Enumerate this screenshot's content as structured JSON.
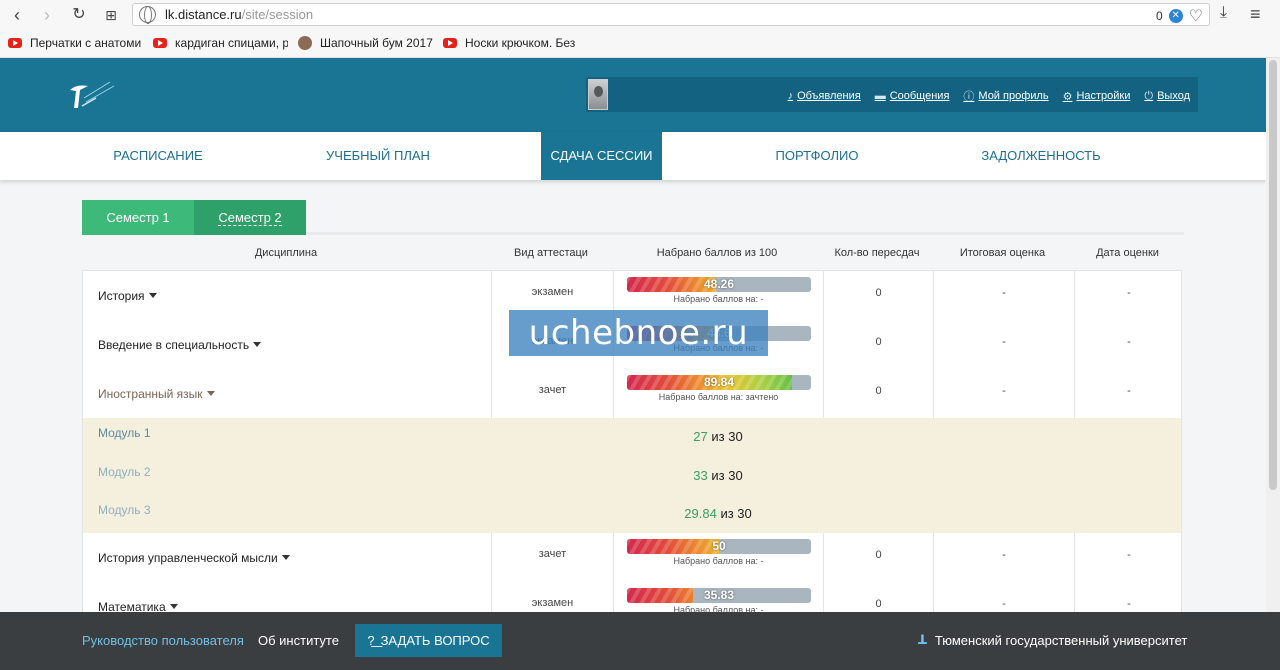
{
  "browser": {
    "url_host": "lk.distance.ru",
    "url_path": "/site/session",
    "badge_count": "0"
  },
  "bookmarks": [
    {
      "label": "Перчатки с анатоми"
    },
    {
      "label": "кардиган спицами, р"
    },
    {
      "label": "Шапочный бум 2017"
    },
    {
      "label": "Носки крючком. Без"
    }
  ],
  "header": {
    "links": [
      {
        "label": "Объявления",
        "icon": "bell-icon"
      },
      {
        "label": "Сообщения",
        "icon": "message-icon"
      },
      {
        "label": "Мой профиль",
        "icon": "info-icon"
      },
      {
        "label": "Настройки",
        "icon": "gear-icon"
      },
      {
        "label": "Выход",
        "icon": "power-icon"
      }
    ]
  },
  "nav": {
    "tabs": [
      {
        "label": "РАСПИСАНИЕ"
      },
      {
        "label": "УЧЕБНЫЙ ПЛАН"
      },
      {
        "label": "СДАЧА СЕССИИ",
        "active": true
      },
      {
        "label": "ПОРТФОЛИО"
      },
      {
        "label": "ЗАДОЛЖЕННОСТЬ"
      }
    ]
  },
  "semesters": {
    "tab1": "Семестр 1",
    "tab2": "Семестр 2"
  },
  "table": {
    "headers": {
      "discipline": "Дисциплина",
      "attestation": "Вид аттестаци",
      "score": "Набрано баллов из 100",
      "retakes": "Кол-во пересдач",
      "final": "Итоговая оценка",
      "date": "Дата оценки"
    },
    "rows": [
      {
        "name": "История",
        "att": "экзамен",
        "score": 48.26,
        "score_label": "48.26",
        "sub": "Набрано баллов на: -",
        "retakes": "0",
        "final": "-",
        "date": "-"
      },
      {
        "name": "Введение в специальность",
        "att": "экзамен",
        "score": 48.6,
        "score_label": "48.6",
        "sub": "Набрано баллов на: -",
        "retakes": "0",
        "final": "-",
        "date": "-"
      },
      {
        "name": "Иностранный язык",
        "att": "зачет",
        "score": 89.84,
        "score_label": "89.84",
        "sub": "Набрано баллов на: зачтено",
        "retakes": "0",
        "final": "-",
        "date": "-"
      }
    ],
    "modules": [
      {
        "name": "Модуль 1",
        "score": "27",
        "of": "из 30"
      },
      {
        "name": "Модуль 2",
        "score": "33",
        "of": "из 30"
      },
      {
        "name": "Модуль 3",
        "score": "29.84",
        "of": "из 30"
      }
    ],
    "rows2": [
      {
        "name": "История управленческой мысли",
        "att": "зачет",
        "score": 50,
        "score_label": "50",
        "sub": "Набрано баллов на: -",
        "retakes": "0",
        "final": "-",
        "date": "-"
      },
      {
        "name": "Математика",
        "att": "экзамен",
        "score": 35.83,
        "score_label": "35.83",
        "sub": "Набрано баллов на: -",
        "retakes": "0",
        "final": "-",
        "date": "-"
      }
    ]
  },
  "watermark": "uchebnoe.ru",
  "footer": {
    "guide": "Руководство пользователя",
    "about": "Об институте",
    "ask": "ЗАДАТЬ ВОПРОС",
    "university": "Тюменский государственный университет"
  }
}
